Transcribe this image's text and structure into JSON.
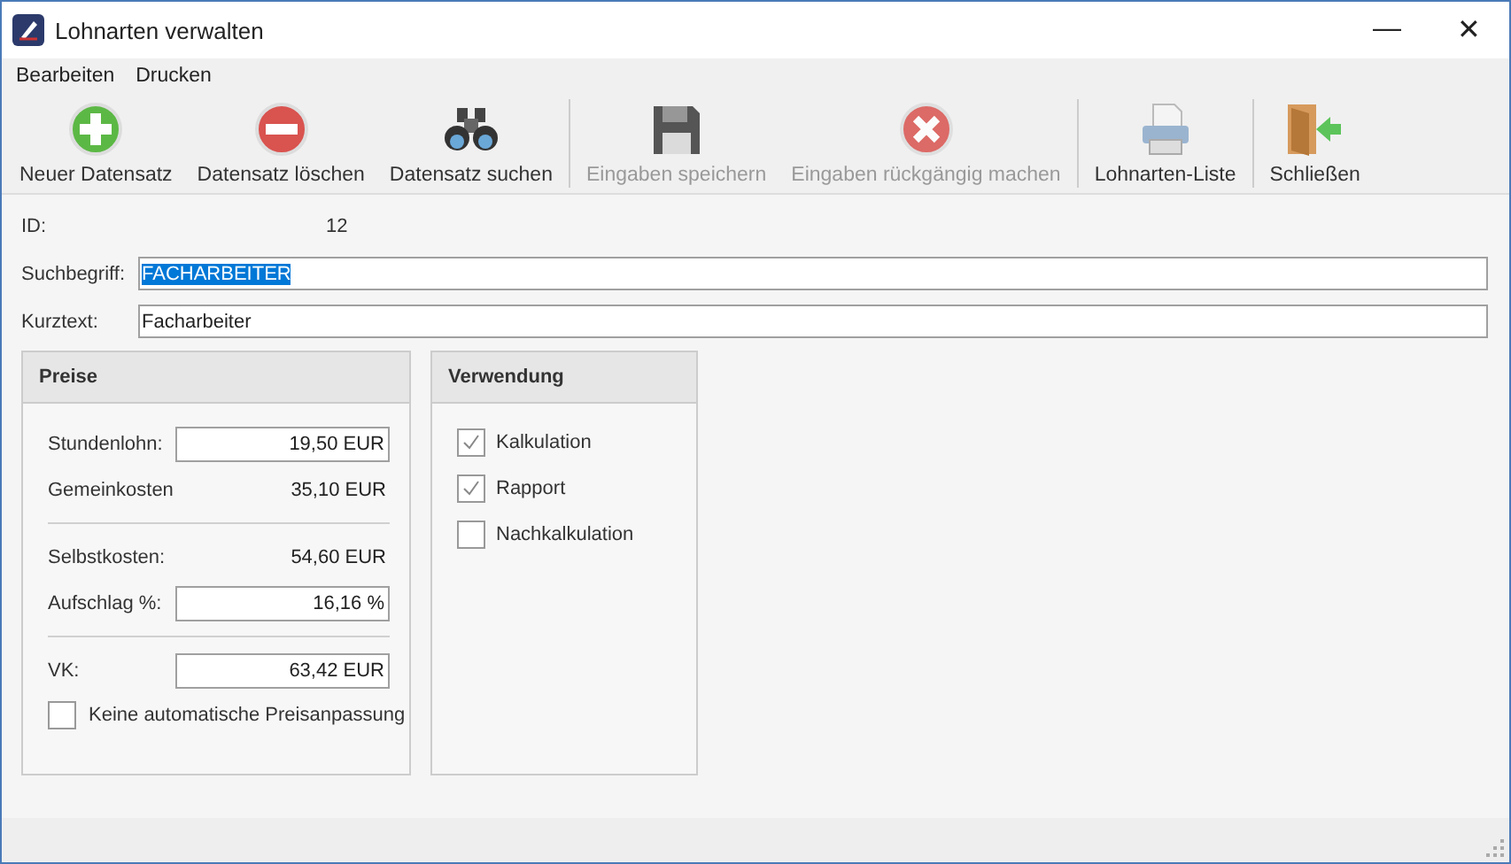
{
  "window": {
    "title": "Lohnarten verwalten",
    "controls": [
      "—",
      "✕"
    ]
  },
  "menu": [
    "Bearbeiten",
    "Drucken"
  ],
  "toolbar": [
    {
      "label": "Neuer Datensatz",
      "disabled": false,
      "separator_after": false
    },
    {
      "label": "Datensatz löschen",
      "disabled": false,
      "separator_after": false
    },
    {
      "label": "Datensatz suchen",
      "disabled": false,
      "separator_after": true
    },
    {
      "label": "Eingaben speichern",
      "disabled": true,
      "separator_after": false
    },
    {
      "label": "Eingaben rückgängig machen",
      "disabled": true,
      "separator_after": true
    },
    {
      "label": "Lohnarten-Liste",
      "disabled": false,
      "separator_after": true
    },
    {
      "label": "Schließen",
      "disabled": false,
      "separator_after": false
    }
  ],
  "fields": [
    {
      "label": "ID:",
      "kind": "text",
      "value": "12"
    },
    {
      "label": "Suchbegriff:",
      "kind": "input",
      "value": "FACHARBEITER",
      "selected": true
    },
    {
      "label": "Kurztext:",
      "kind": "input",
      "value": "Facharbeiter",
      "selected": false
    }
  ],
  "preise": {
    "title": "Preise",
    "rows": [
      {
        "label": "Stundenlohn:",
        "kind": "input",
        "value": "19,50 EUR",
        "divider_before": false
      },
      {
        "label": "Gemeinkosten",
        "kind": "text",
        "value": "35,10 EUR",
        "divider_before": false
      },
      {
        "label": "Selbstkosten:",
        "kind": "text",
        "value": "54,60 EUR",
        "divider_before": true
      },
      {
        "label": "Aufschlag %:",
        "kind": "input",
        "value": "16,16 %",
        "divider_before": false
      },
      {
        "label": "VK:",
        "kind": "input",
        "value": "63,42 EUR",
        "divider_before": true
      }
    ],
    "option": {
      "label": "Keine automatische Preisanpassung",
      "checked": false
    }
  },
  "verwendung": {
    "title": "Verwendung",
    "items": [
      {
        "label": "Kalkulation",
        "checked": true
      },
      {
        "label": "Rapport",
        "checked": true
      },
      {
        "label": "Nachkalkulation",
        "checked": false
      }
    ]
  }
}
